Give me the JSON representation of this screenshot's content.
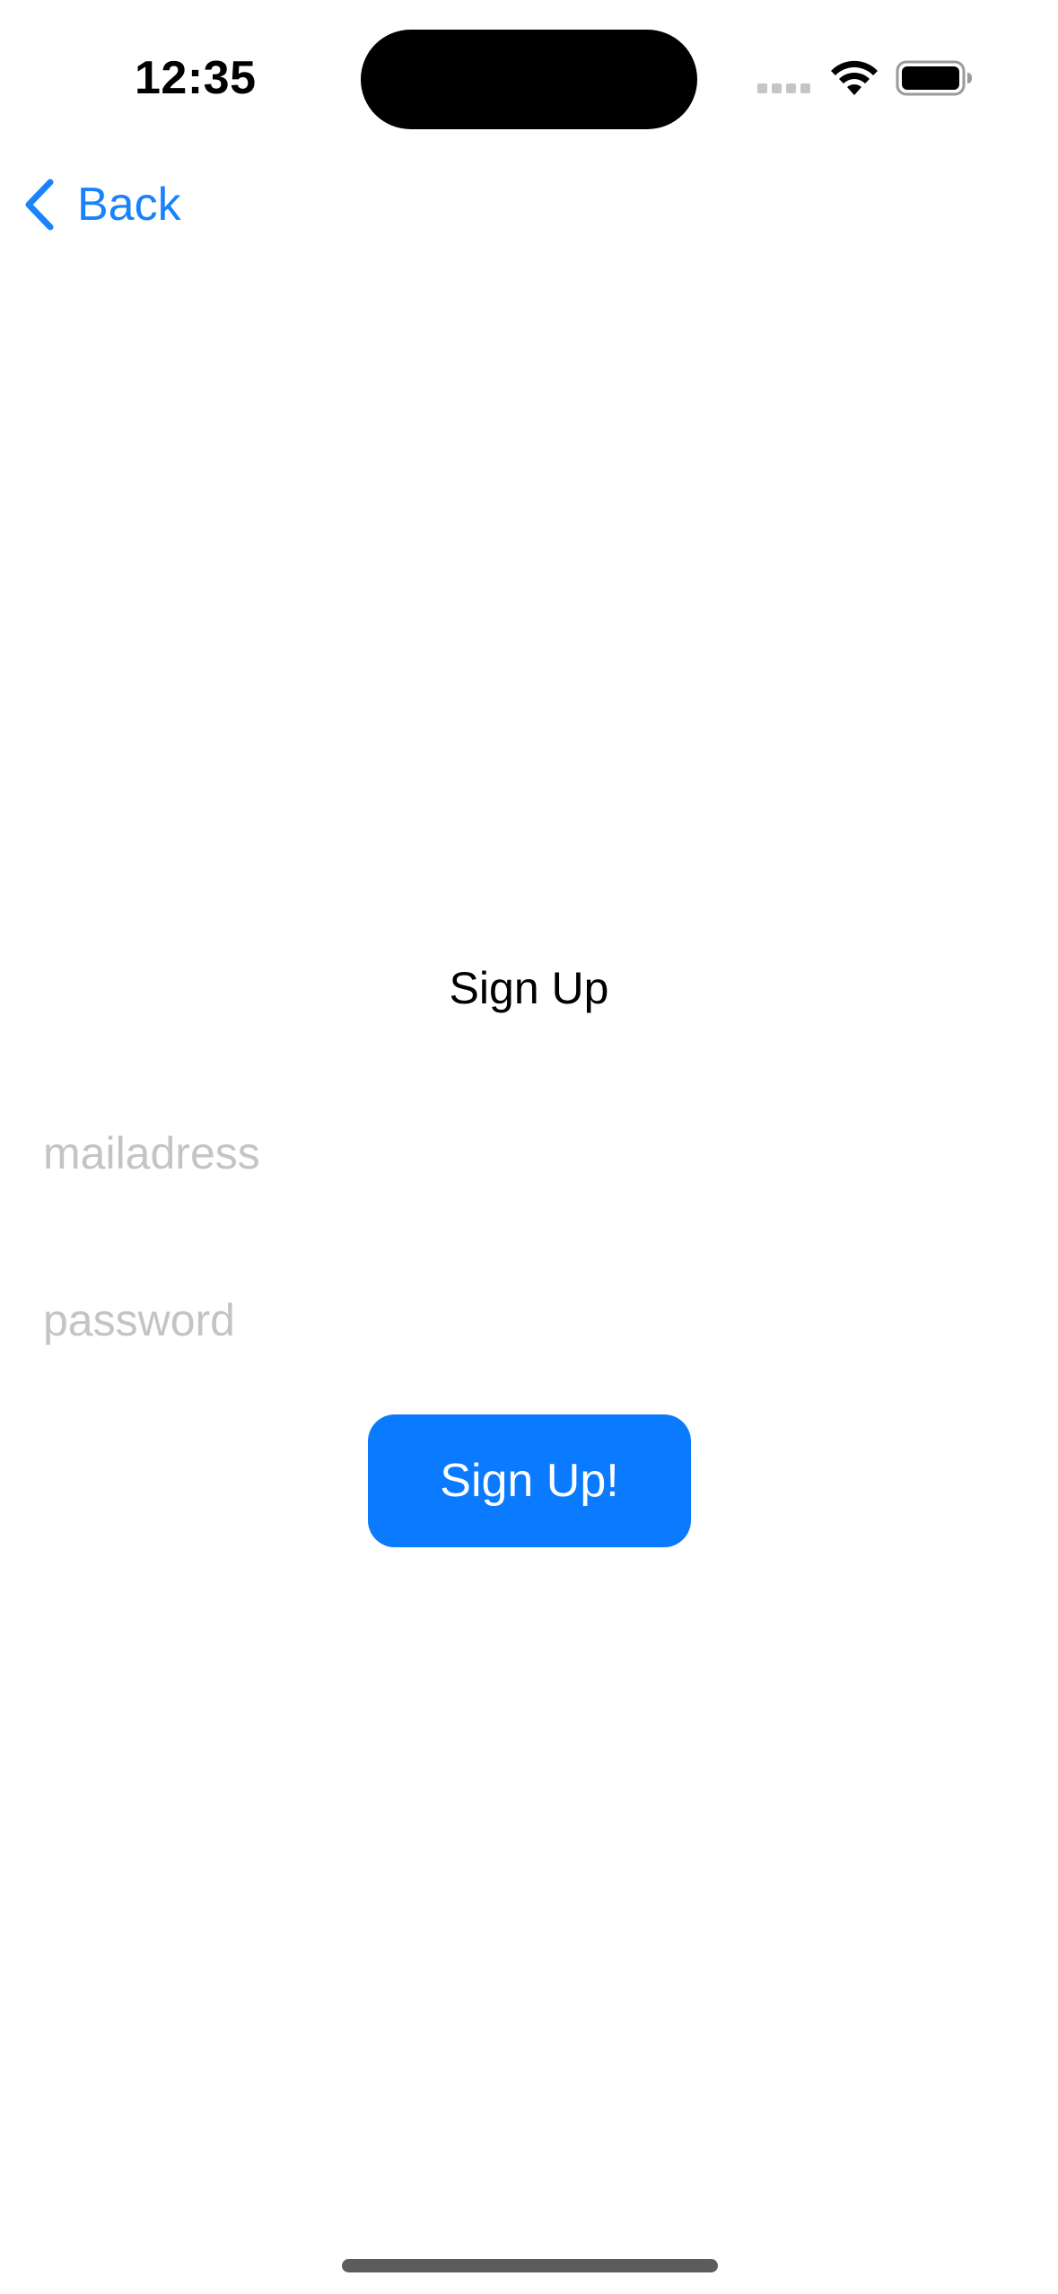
{
  "status_bar": {
    "time": "12:35",
    "signal_icon": "cellular-signal-icon",
    "wifi_icon": "wifi-icon",
    "battery_icon": "battery-icon"
  },
  "nav": {
    "back_label": "Back",
    "back_icon": "chevron-left-icon"
  },
  "page": {
    "title": "Sign Up"
  },
  "form": {
    "email_placeholder": "mailadress",
    "email_value": "",
    "password_placeholder": "password",
    "password_value": "",
    "submit_label": "Sign Up!"
  },
  "colors": {
    "accent": "#0a7aff",
    "back_link": "#1a82fb",
    "placeholder": "#c4c4c7",
    "background": "#ffffff"
  }
}
